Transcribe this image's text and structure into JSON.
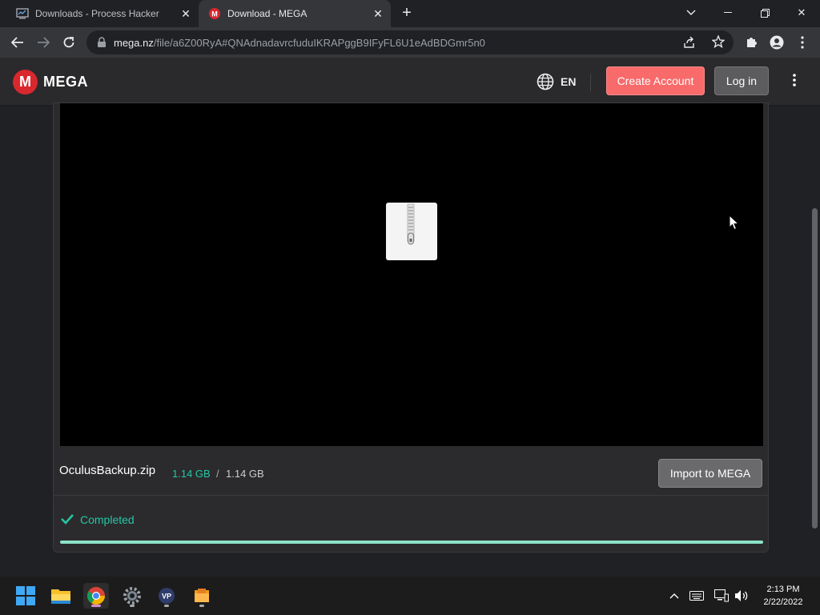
{
  "browser": {
    "tabs": [
      {
        "title": "Downloads - Process Hacker",
        "active": false
      },
      {
        "title": "Download - MEGA",
        "active": true
      }
    ],
    "url_host": "mega.nz",
    "url_path": "/file/a6Z00RyA#QNAdnadavrcfuduIKRAPggB9IFyFL6U1eAdBDGmr5n0"
  },
  "header": {
    "logo_mark": "M",
    "logo_text": "MEGA",
    "language": "EN",
    "create_account": "Create Account",
    "login": "Log in"
  },
  "file": {
    "name": "OculusBackup.zip",
    "downloaded": "1.14 GB",
    "separator": "/",
    "total": "1.14 GB",
    "import_button": "Import to MEGA",
    "status": "Completed",
    "progress": 1.0
  },
  "taskbar": {
    "time": "2:13 PM",
    "date": "2/22/2022"
  },
  "colors": {
    "accent_red": "#d9272e",
    "create_button": "#f96a6a",
    "success_teal": "#26c6a6",
    "progress_fill": "#8de3c8"
  },
  "icons": [
    "process-hacker-icon",
    "mega-favicon-icon",
    "close-icon",
    "new-tab-icon",
    "back-icon",
    "forward-icon",
    "reload-icon",
    "lock-icon",
    "share-icon",
    "bookmark-star-icon",
    "extensions-icon",
    "profile-icon",
    "kebab-menu-icon",
    "globe-icon",
    "zip-file-icon",
    "checkmark-icon",
    "windows-start-icon",
    "file-explorer-icon",
    "chrome-icon",
    "settings-icon",
    "vpn-icon",
    "folder-icon",
    "chevron-up-icon",
    "keyboard-icon",
    "network-icon",
    "volume-icon"
  ]
}
